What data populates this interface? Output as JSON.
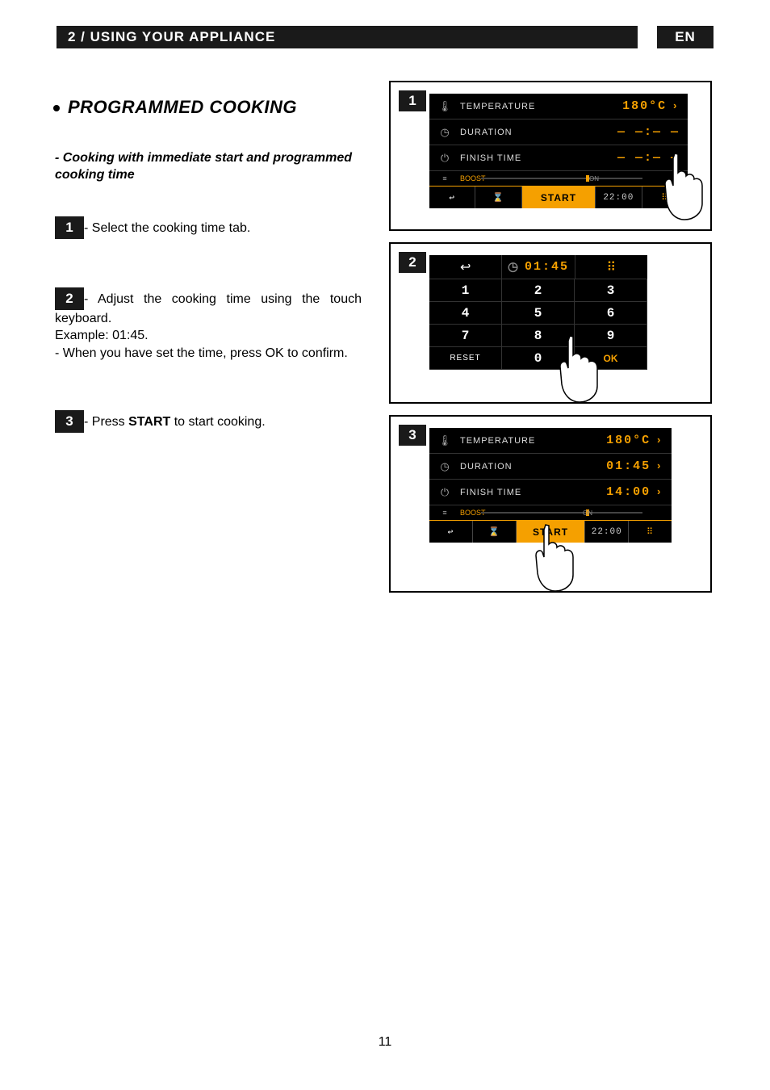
{
  "header": {
    "title": "2 / USING YOUR APPLIANCE",
    "lang": "EN"
  },
  "section": {
    "title": "PROGRAMMED COOKING",
    "subheading": "- Cooking with immediate start and programmed cooking time"
  },
  "steps": {
    "s1": {
      "num": "1",
      "text": "- Select the cooking time tab."
    },
    "s2": {
      "num": "2",
      "line1": "- Adjust the cooking time using the touch keyboard.",
      "line2": "Example: 01:45.",
      "line3": "- When you have set the time, press OK to confirm."
    },
    "s3": {
      "num": "3",
      "pre": "- Press ",
      "bold": "START",
      "post": " to start cooking."
    }
  },
  "panel1": {
    "badge": "1",
    "rows": {
      "temperature": {
        "label": "TEMPERATURE",
        "value": "180°C"
      },
      "duration": {
        "label": "DURATION",
        "value": "— —:— —"
      },
      "finish": {
        "label": "FINISH TIME",
        "value": "— —:— —"
      },
      "boost": {
        "label": "BOOST",
        "status": "ON"
      }
    },
    "toolbar": {
      "back": "↩",
      "timer": "⌛",
      "start": "START",
      "clock": "22:00",
      "grid": "⠿"
    }
  },
  "panel2": {
    "badge": "2",
    "top": {
      "back": "↩",
      "time": "01:45",
      "grid": "⠿"
    },
    "keys": {
      "k1": "1",
      "k2": "2",
      "k3": "3",
      "k4": "4",
      "k5": "5",
      "k6": "6",
      "k7": "7",
      "k8": "8",
      "k9": "9",
      "reset": "RESET",
      "k0": "0",
      "ok": "OK"
    }
  },
  "panel3": {
    "badge": "3",
    "rows": {
      "temperature": {
        "label": "TEMPERATURE",
        "value": "180°C"
      },
      "duration": {
        "label": "DURATION",
        "value": "01:45"
      },
      "finish": {
        "label": "FINISH TIME",
        "value": "14:00"
      },
      "boost": {
        "label": "BOOST",
        "status": "ON"
      }
    },
    "toolbar": {
      "back": "↩",
      "timer": "⌛",
      "start": "START",
      "clock": "22:00",
      "grid": "⠿"
    }
  },
  "page_number": "11"
}
